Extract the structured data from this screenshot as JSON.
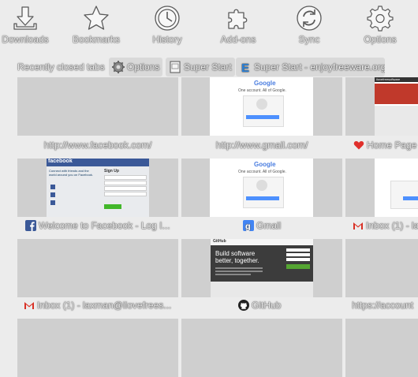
{
  "toolbar": {
    "items": [
      {
        "label": "Downloads",
        "icon": "download-icon"
      },
      {
        "label": "Bookmarks",
        "icon": "star-icon"
      },
      {
        "label": "History",
        "icon": "clock-icon"
      },
      {
        "label": "Add-ons",
        "icon": "puzzle-icon"
      },
      {
        "label": "Sync",
        "icon": "sync-icon"
      },
      {
        "label": "Options",
        "icon": "gear-icon"
      }
    ]
  },
  "recently_closed": {
    "label": "Recently closed tabs",
    "tabs": [
      {
        "label": "Options",
        "icon": "gear-icon"
      },
      {
        "label": "Super Start",
        "icon": "page-icon"
      },
      {
        "label": "Super Start - enjoyfreeware.org",
        "icon": "e-icon"
      }
    ]
  },
  "dials": [
    {
      "title": "http://www.facebook.com/",
      "thumb": "blank"
    },
    {
      "title": "http://www.gmail.com/",
      "thumb": "google"
    },
    {
      "title": "Home Page",
      "thumb": "ilovefree",
      "favicon": "heart-icon"
    },
    {
      "title": "Welcome to Facebook - Log I...",
      "thumb": "facebook",
      "favicon": "facebook-icon"
    },
    {
      "title": "Gmail",
      "thumb": "google",
      "favicon": "google-icon"
    },
    {
      "title": "Inbox (1) - la",
      "thumb": "google-partial",
      "favicon": "gmail-icon"
    },
    {
      "title": "",
      "thumb": "blank"
    },
    {
      "title": "GitHub",
      "thumb": "github",
      "favicon": "github-icon"
    },
    {
      "title": "",
      "thumb": "blank"
    },
    {
      "title": "Inbox (1) - laxman@ilovefrees...",
      "favicon": "gmail-icon"
    },
    {
      "title": "https://account",
      "favicon": ""
    },
    {
      "title": "",
      "thumb": "blank"
    },
    {
      "title": "",
      "thumb": "blank"
    },
    {
      "title": "",
      "thumb": "blank"
    }
  ],
  "thumbs": {
    "google_header": "Google",
    "google_sub": "One account. All of Google.",
    "google_sign": "Sign in to continue to Gmail",
    "facebook_brand": "facebook",
    "facebook_connect": "Connect with friends and the world around you on Facebook.",
    "facebook_signup": "Sign Up",
    "github_brand": "GitHub",
    "github_headline": "Build software better, together.",
    "ilovefree_brand": "ilovefreesoftware"
  },
  "colors": {
    "background": "#ececec",
    "tile": "#cfcfcf",
    "facebook": "#3b5998",
    "google_blue": "#4285f4",
    "gmail_red": "#d93025",
    "heart": "#e0302c",
    "github_dark": "#2b2b2b",
    "ilovefree_red": "#c0392b"
  }
}
